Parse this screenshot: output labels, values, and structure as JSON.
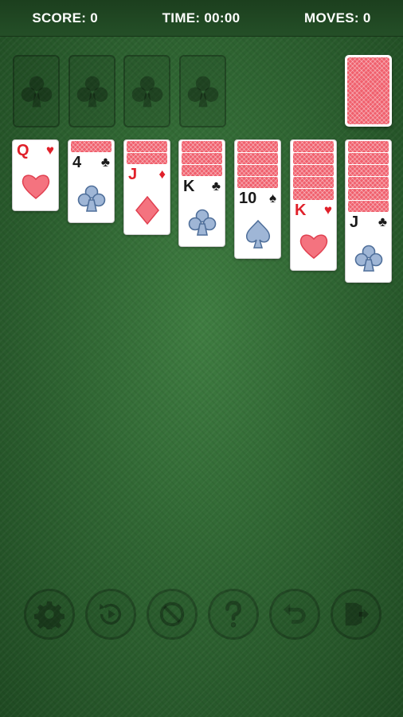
{
  "header": {
    "score_label": "SCORE:",
    "score_value": "0",
    "time_label": "TIME:",
    "time_value": "00:00",
    "moves_label": "MOVES:",
    "moves_value": "0"
  },
  "foundations": [
    {
      "icon": "club-icon"
    },
    {
      "icon": "club-icon"
    },
    {
      "icon": "club-icon"
    },
    {
      "icon": "club-icon"
    }
  ],
  "stock": {
    "state": "face-down"
  },
  "tableau": [
    {
      "face_down": 0,
      "rank": "Q",
      "suit": "heart",
      "symbol": "♥",
      "color": "red"
    },
    {
      "face_down": 1,
      "rank": "4",
      "suit": "club",
      "symbol": "♣",
      "color": "black"
    },
    {
      "face_down": 2,
      "rank": "J",
      "suit": "diamond",
      "symbol": "♦",
      "color": "red"
    },
    {
      "face_down": 3,
      "rank": "K",
      "suit": "club",
      "symbol": "♣",
      "color": "black"
    },
    {
      "face_down": 4,
      "rank": "10",
      "suit": "spade",
      "symbol": "♠",
      "color": "black"
    },
    {
      "face_down": 5,
      "rank": "K",
      "suit": "heart",
      "symbol": "♥",
      "color": "red"
    },
    {
      "face_down": 6,
      "rank": "J",
      "suit": "club",
      "symbol": "♣",
      "color": "black"
    }
  ],
  "toolbar": [
    {
      "icon": "gear-icon"
    },
    {
      "icon": "replay-icon"
    },
    {
      "icon": "cancel-icon"
    },
    {
      "icon": "help-icon"
    },
    {
      "icon": "undo-icon"
    },
    {
      "icon": "exit-icon"
    }
  ],
  "colors": {
    "felt": "#2f6532",
    "card_back": "#f0606d",
    "red_suit": "#e0202a",
    "heart_fill": "#f4737f",
    "club_fill": "#9fb6d6",
    "club_stroke": "#4f6f9a"
  }
}
